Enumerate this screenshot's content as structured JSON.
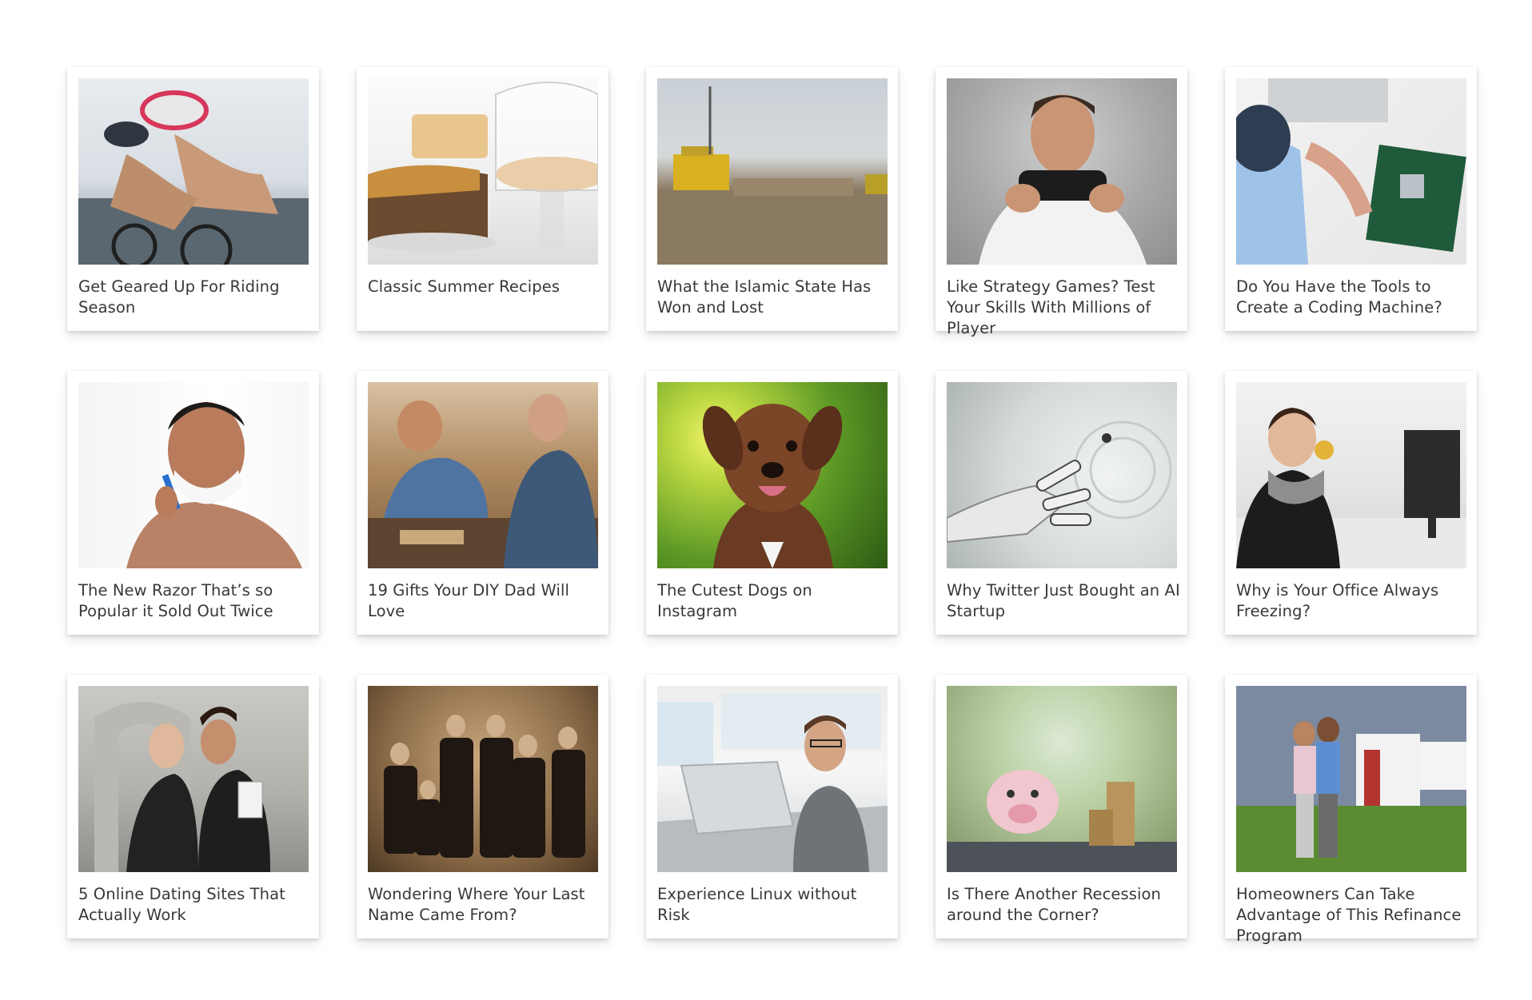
{
  "articles": [
    {
      "title": "Get Geared Up For Riding Season"
    },
    {
      "title": "Classic Summer Recipes"
    },
    {
      "title": "What the Islamic State Has Won and Lost"
    },
    {
      "title": "Like Strategy Games? Test Your Skills With Millions of Player"
    },
    {
      "title": "Do You Have the Tools to Create a Coding Machine?"
    },
    {
      "title": "The New Razor That’s so Popular it Sold Out Twice"
    },
    {
      "title": "19 Gifts Your DIY Dad Will Love"
    },
    {
      "title": "The Cutest Dogs on Instagram"
    },
    {
      "title": "Why Twitter Just Bought an AI Startup"
    },
    {
      "title": "Why is Your Office Always Freezing?"
    },
    {
      "title": "5 Online Dating Sites That Actually Work"
    },
    {
      "title": "Wondering Where Your Last Name Came From?"
    },
    {
      "title": "Experience Linux without Risk"
    },
    {
      "title": "Is There Another Recession around the Corner?"
    },
    {
      "title": "Homeowners Can Take Advantage of This Refinance Program"
    }
  ]
}
